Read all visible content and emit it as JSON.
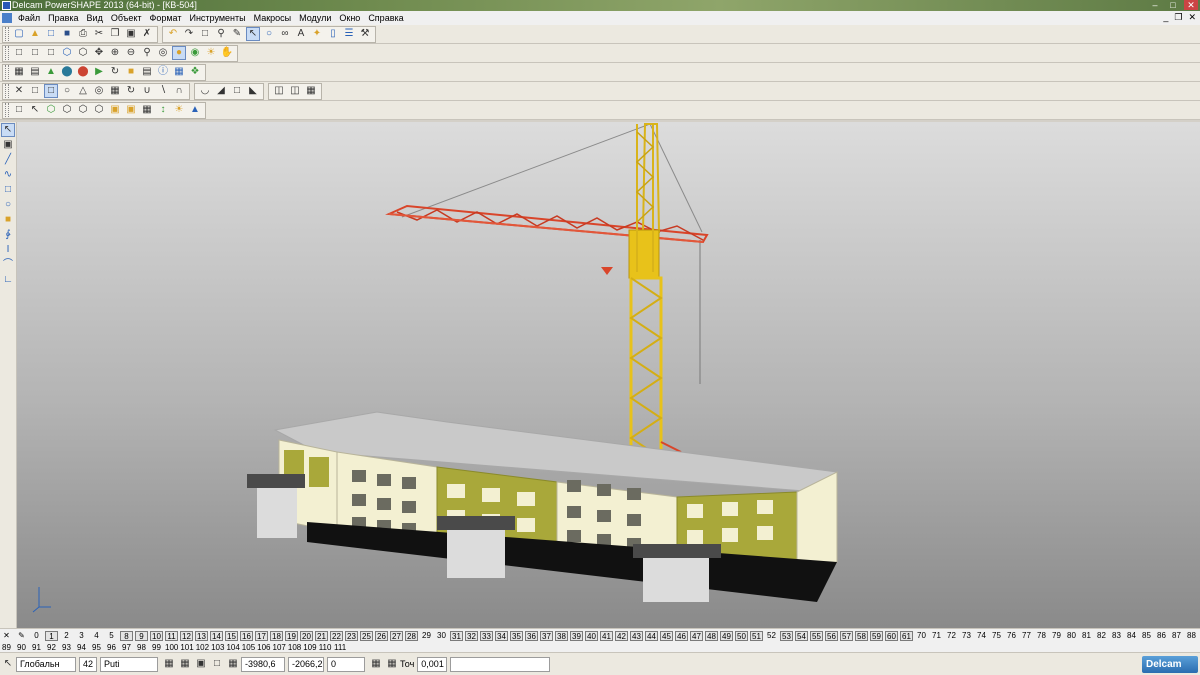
{
  "window": {
    "title": "Delcam PowerSHAPE 2013 (64-bit) - [КВ-504]"
  },
  "menu": [
    "Файл",
    "Правка",
    "Вид",
    "Объект",
    "Формат",
    "Инструменты",
    "Макросы",
    "Модули",
    "Окно",
    "Справка"
  ],
  "levels": {
    "row1": [
      {
        "n": "0",
        "b": false
      },
      {
        "n": "1",
        "b": true
      },
      {
        "n": "2",
        "b": false
      },
      {
        "n": "3",
        "b": false
      },
      {
        "n": "4",
        "b": false
      },
      {
        "n": "5",
        "b": false
      },
      {
        "n": "8",
        "b": true
      },
      {
        "n": "9",
        "b": true
      },
      {
        "n": "10",
        "b": true
      },
      {
        "n": "11",
        "b": true
      },
      {
        "n": "12",
        "b": true
      },
      {
        "n": "13",
        "b": true
      },
      {
        "n": "14",
        "b": true
      },
      {
        "n": "15",
        "b": true
      },
      {
        "n": "16",
        "b": true
      },
      {
        "n": "17",
        "b": true
      },
      {
        "n": "18",
        "b": true
      },
      {
        "n": "19",
        "b": true
      },
      {
        "n": "20",
        "b": true
      },
      {
        "n": "21",
        "b": true
      },
      {
        "n": "22",
        "b": true
      },
      {
        "n": "23",
        "b": true
      },
      {
        "n": "25",
        "b": true
      },
      {
        "n": "26",
        "b": true
      },
      {
        "n": "27",
        "b": true
      },
      {
        "n": "28",
        "b": true
      },
      {
        "n": "29",
        "b": false
      },
      {
        "n": "30",
        "b": false
      },
      {
        "n": "31",
        "b": true
      },
      {
        "n": "32",
        "b": true
      },
      {
        "n": "33",
        "b": true
      },
      {
        "n": "34",
        "b": true
      },
      {
        "n": "35",
        "b": true
      },
      {
        "n": "36",
        "b": true
      },
      {
        "n": "37",
        "b": true
      },
      {
        "n": "38",
        "b": true
      },
      {
        "n": "39",
        "b": true
      },
      {
        "n": "40",
        "b": true
      },
      {
        "n": "41",
        "b": true
      },
      {
        "n": "42",
        "b": true
      },
      {
        "n": "43",
        "b": true
      },
      {
        "n": "44",
        "b": true
      },
      {
        "n": "45",
        "b": true
      },
      {
        "n": "46",
        "b": true
      },
      {
        "n": "47",
        "b": true
      },
      {
        "n": "48",
        "b": true
      },
      {
        "n": "49",
        "b": true
      },
      {
        "n": "50",
        "b": true
      },
      {
        "n": "51",
        "b": true
      },
      {
        "n": "52",
        "b": false
      },
      {
        "n": "53",
        "b": true
      },
      {
        "n": "54",
        "b": true
      },
      {
        "n": "55",
        "b": true
      },
      {
        "n": "56",
        "b": true
      },
      {
        "n": "57",
        "b": true
      },
      {
        "n": "58",
        "b": true
      },
      {
        "n": "59",
        "b": true
      },
      {
        "n": "60",
        "b": true
      },
      {
        "n": "61",
        "b": true
      },
      {
        "n": "70",
        "b": false
      },
      {
        "n": "71",
        "b": false
      },
      {
        "n": "72",
        "b": false
      },
      {
        "n": "73",
        "b": false
      },
      {
        "n": "74",
        "b": false
      },
      {
        "n": "75",
        "b": false
      },
      {
        "n": "76",
        "b": false
      },
      {
        "n": "77",
        "b": false
      },
      {
        "n": "78",
        "b": false
      },
      {
        "n": "79",
        "b": false
      },
      {
        "n": "80",
        "b": false
      },
      {
        "n": "81",
        "b": false
      },
      {
        "n": "82",
        "b": false
      },
      {
        "n": "83",
        "b": false
      },
      {
        "n": "84",
        "b": false
      },
      {
        "n": "85",
        "b": false
      },
      {
        "n": "86",
        "b": false
      },
      {
        "n": "87",
        "b": false
      },
      {
        "n": "88",
        "b": false
      }
    ],
    "row2": [
      "89",
      "90",
      "91",
      "92",
      "93",
      "94",
      "95",
      "96",
      "97",
      "98",
      "99",
      "100",
      "101",
      "102",
      "103",
      "104",
      "105",
      "106",
      "107",
      "108",
      "109",
      "110",
      "111"
    ]
  },
  "status": {
    "workplane": "Глобальн",
    "level_num": "42",
    "level_name": "Puti",
    "coord_x": "-3980,6",
    "coord_y": "-2066,2",
    "coord_z": "0",
    "tolerance_label": "Точ",
    "tolerance_value": "0,001",
    "brand": "Delcam"
  },
  "colors": {
    "crane_yellow": "#e8c21a",
    "crane_jib": "#d9452a",
    "wall_cream": "#f3f0d2",
    "wall_olive": "#a9a83a"
  }
}
